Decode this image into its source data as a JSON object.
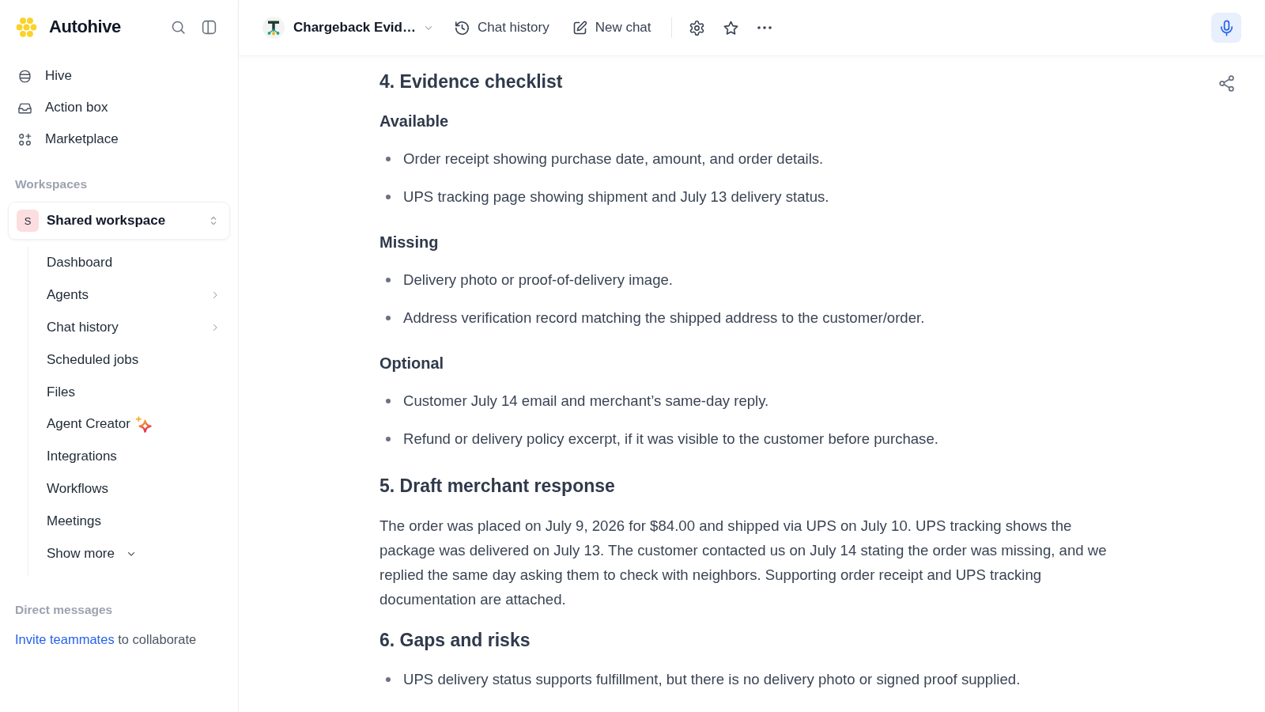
{
  "sidebar": {
    "brand": "Autohive",
    "nav": [
      {
        "label": "Hive"
      },
      {
        "label": "Action box"
      },
      {
        "label": "Marketplace"
      }
    ],
    "workspaces_label": "Workspaces",
    "workspace": {
      "initial": "S",
      "name": "Shared workspace"
    },
    "workspace_items": [
      {
        "label": "Dashboard",
        "kind": "link"
      },
      {
        "label": "Agents",
        "kind": "group"
      },
      {
        "label": "Chat history",
        "kind": "group"
      },
      {
        "label": "Scheduled jobs",
        "kind": "link"
      },
      {
        "label": "Files",
        "kind": "link"
      },
      {
        "label": "Agent Creator",
        "kind": "featured"
      },
      {
        "label": "Integrations",
        "kind": "link"
      },
      {
        "label": "Workflows",
        "kind": "link"
      },
      {
        "label": "Meetings",
        "kind": "link"
      }
    ],
    "show_more": "Show more",
    "direct_messages_label": "Direct messages",
    "invite": {
      "link": "Invite teammates",
      "text": "to collaborate"
    }
  },
  "header": {
    "agent_name": "Chargeback Evid…",
    "actions": [
      {
        "label": "Chat history"
      },
      {
        "label": "New chat"
      }
    ]
  },
  "content": {
    "blocks": [
      {
        "kind": "heading",
        "text": "4. Evidence checklist"
      },
      {
        "kind": "subheading",
        "text": "Available"
      },
      {
        "kind": "bullets",
        "items": [
          "Order receipt showing purchase date, amount, and order details.",
          "UPS tracking page showing shipment and July 13 delivery status."
        ]
      },
      {
        "kind": "subheading",
        "text": "Missing"
      },
      {
        "kind": "bullets",
        "items": [
          "Delivery photo or proof-of-delivery image.",
          "Address verification record matching the shipped address to the customer/order."
        ]
      },
      {
        "kind": "subheading",
        "text": "Optional"
      },
      {
        "kind": "bullets",
        "items": [
          "Customer July 14 email and merchant’s same-day reply.",
          "Refund or delivery policy excerpt, if it was visible to the customer before purchase."
        ]
      },
      {
        "kind": "heading",
        "text": "5. Draft merchant response"
      },
      {
        "kind": "paragraph",
        "text": "The order was placed on July 9, 2026 for $84.00 and shipped via UPS on July 10. UPS tracking shows the package was delivered on July 13. The customer contacted us on July 14 stating the order was missing, and we replied the same day asking them to check with neighbors. Supporting order receipt and UPS tracking documentation are attached."
      },
      {
        "kind": "heading",
        "text": "6. Gaps and risks"
      },
      {
        "kind": "bullets",
        "items": [
          "UPS delivery status supports fulfillment, but there is no delivery photo or signed proof supplied."
        ]
      }
    ]
  }
}
